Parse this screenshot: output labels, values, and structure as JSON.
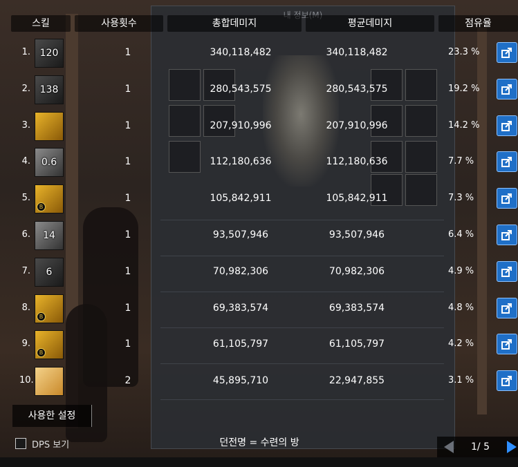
{
  "header": {
    "skill": "스킬",
    "uses": "사용횟수",
    "total": "총합데미지",
    "avg": "평균데미지",
    "share": "점유율"
  },
  "rows": [
    {
      "num": "1.",
      "icon_text": "120",
      "icon_style": "dark",
      "badge": false,
      "uses": "1",
      "total": "340,118,482",
      "avg": "340,118,482",
      "share": "23.3 %"
    },
    {
      "num": "2.",
      "icon_text": "138",
      "icon_style": "dark",
      "badge": false,
      "uses": "1",
      "total": "280,543,575",
      "avg": "280,543,575",
      "share": "19.2 %"
    },
    {
      "num": "3.",
      "icon_text": "",
      "icon_style": "gold",
      "badge": false,
      "uses": "1",
      "total": "207,910,996",
      "avg": "207,910,996",
      "share": "14.2 %"
    },
    {
      "num": "4.",
      "icon_text": "0.6",
      "icon_style": "grey",
      "badge": false,
      "uses": "1",
      "total": "112,180,636",
      "avg": "112,180,636",
      "share": "7.7 %"
    },
    {
      "num": "5.",
      "icon_text": "",
      "icon_style": "gold",
      "badge": true,
      "uses": "1",
      "total": "105,842,911",
      "avg": "105,842,911",
      "share": "7.3 %"
    },
    {
      "num": "6.",
      "icon_text": "14",
      "icon_style": "grey",
      "badge": false,
      "uses": "1",
      "total": "93,507,946",
      "avg": "93,507,946",
      "share": "6.4 %"
    },
    {
      "num": "7.",
      "icon_text": "6",
      "icon_style": "dark",
      "badge": false,
      "uses": "1",
      "total": "70,982,306",
      "avg": "70,982,306",
      "share": "4.9 %"
    },
    {
      "num": "8.",
      "icon_text": "",
      "icon_style": "gold",
      "badge": true,
      "uses": "1",
      "total": "69,383,574",
      "avg": "69,383,574",
      "share": "4.8 %"
    },
    {
      "num": "9.",
      "icon_text": "",
      "icon_style": "gold",
      "badge": true,
      "uses": "1",
      "total": "61,105,797",
      "avg": "61,105,797",
      "share": "4.2 %"
    },
    {
      "num": "10.",
      "icon_text": "",
      "icon_style": "paper",
      "badge": false,
      "uses": "2",
      "total": "45,895,710",
      "avg": "22,947,855",
      "share": "3.1 %"
    }
  ],
  "badge_letter": "B",
  "used_settings": "사용한 설정",
  "dps_label": "DPS 보기",
  "dungeon": "던전명 = 수련의 방",
  "pager": {
    "label": "1/ 5"
  },
  "background": {
    "panel_title": "내 정보(M)"
  },
  "colors": {
    "share_button": "#1f6fc7",
    "pager_next": "#2f8fff"
  }
}
